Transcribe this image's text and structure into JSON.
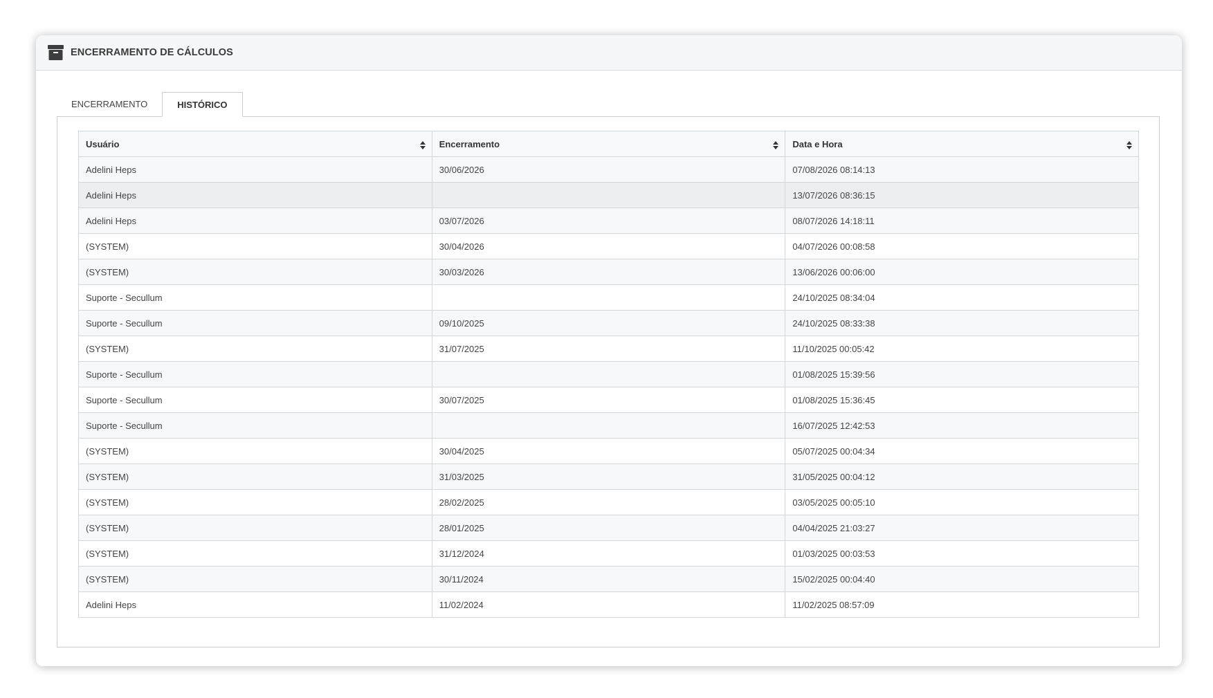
{
  "panel": {
    "title": "ENCERRAMENTO DE CÁLCULOS",
    "icon": "archive-icon"
  },
  "tabs": [
    {
      "label": "ENCERRAMENTO",
      "active": false
    },
    {
      "label": "HISTÓRICO",
      "active": true
    }
  ],
  "table": {
    "columns": [
      "Usuário",
      "Encerramento",
      "Data e Hora"
    ],
    "sort_icon": "sort-icon",
    "rows": [
      {
        "user": "Adelini Heps",
        "closing": "30/06/2026",
        "datetime": "07/08/2026 08:14:13"
      },
      {
        "user": "Adelini Heps",
        "closing": "",
        "datetime": "13/07/2026 08:36:15"
      },
      {
        "user": "Adelini Heps",
        "closing": "03/07/2026",
        "datetime": "08/07/2026 14:18:11"
      },
      {
        "user": "(SYSTEM)",
        "closing": "30/04/2026",
        "datetime": "04/07/2026 00:08:58"
      },
      {
        "user": "(SYSTEM)",
        "closing": "30/03/2026",
        "datetime": "13/06/2026 00:06:00"
      },
      {
        "user": "Suporte - Secullum",
        "closing": "",
        "datetime": "24/10/2025 08:34:04"
      },
      {
        "user": "Suporte - Secullum",
        "closing": "09/10/2025",
        "datetime": "24/10/2025 08:33:38"
      },
      {
        "user": "(SYSTEM)",
        "closing": "31/07/2025",
        "datetime": "11/10/2025 00:05:42"
      },
      {
        "user": "Suporte - Secullum",
        "closing": "",
        "datetime": "01/08/2025 15:39:56"
      },
      {
        "user": "Suporte - Secullum",
        "closing": "30/07/2025",
        "datetime": "01/08/2025 15:36:45"
      },
      {
        "user": "Suporte - Secullum",
        "closing": "",
        "datetime": "16/07/2025 12:42:53"
      },
      {
        "user": "(SYSTEM)",
        "closing": "30/04/2025",
        "datetime": "05/07/2025 00:04:34"
      },
      {
        "user": "(SYSTEM)",
        "closing": "31/03/2025",
        "datetime": "31/05/2025 00:04:12"
      },
      {
        "user": "(SYSTEM)",
        "closing": "28/02/2025",
        "datetime": "03/05/2025 00:05:10"
      },
      {
        "user": "(SYSTEM)",
        "closing": "28/01/2025",
        "datetime": "04/04/2025 21:03:27"
      },
      {
        "user": "(SYSTEM)",
        "closing": "31/12/2024",
        "datetime": "01/03/2025 00:03:53"
      },
      {
        "user": "(SYSTEM)",
        "closing": "30/11/2024",
        "datetime": "15/02/2025 00:04:40"
      },
      {
        "user": "Adelini Heps",
        "closing": "11/02/2024",
        "datetime": "11/02/2025 08:57:09"
      }
    ]
  }
}
